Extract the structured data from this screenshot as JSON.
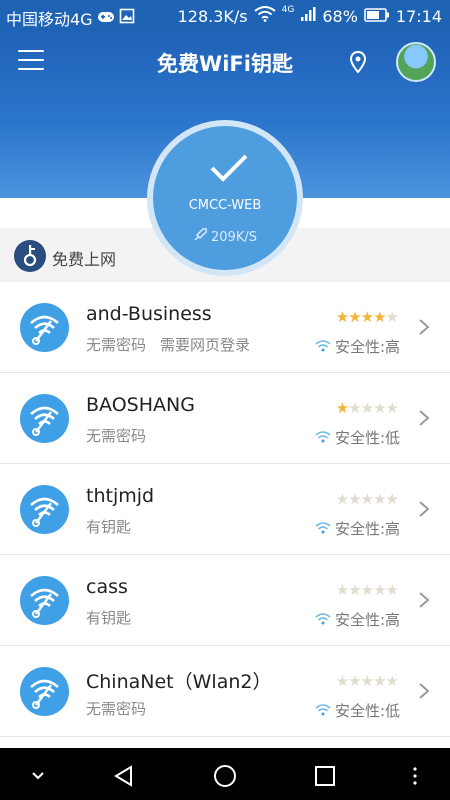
{
  "status_bar": {
    "carrier": "中国移动4G",
    "speed": "128.3K/s",
    "network_type": "4G",
    "battery": "68%",
    "time": "17:14"
  },
  "header": {
    "title": "免费WiFi钥匙"
  },
  "connected": {
    "ssid": "CMCC-WEB",
    "speed": "209K/S"
  },
  "section": {
    "label": "免费上网"
  },
  "networks": [
    {
      "ssid": "and-Business",
      "tags": [
        "无需密码",
        "需要网页登录"
      ],
      "stars": 4,
      "safety": "安全性:高"
    },
    {
      "ssid": "BAOSHANG",
      "tags": [
        "无需密码"
      ],
      "stars": 1,
      "safety": "安全性:低"
    },
    {
      "ssid": "thtjmjd",
      "tags": [
        "有钥匙"
      ],
      "stars": 0,
      "safety": "安全性:高"
    },
    {
      "ssid": "cass",
      "tags": [
        "有钥匙"
      ],
      "stars": 0,
      "safety": "安全性:高"
    },
    {
      "ssid": "ChinaNet（Wlan2）",
      "tags": [
        "无需密码"
      ],
      "stars": 0,
      "safety": "安全性:低"
    }
  ],
  "colors": {
    "header_blue": "#2063b8",
    "wifi_blue": "#3fa0e5",
    "star_gold": "#f2b43a"
  }
}
